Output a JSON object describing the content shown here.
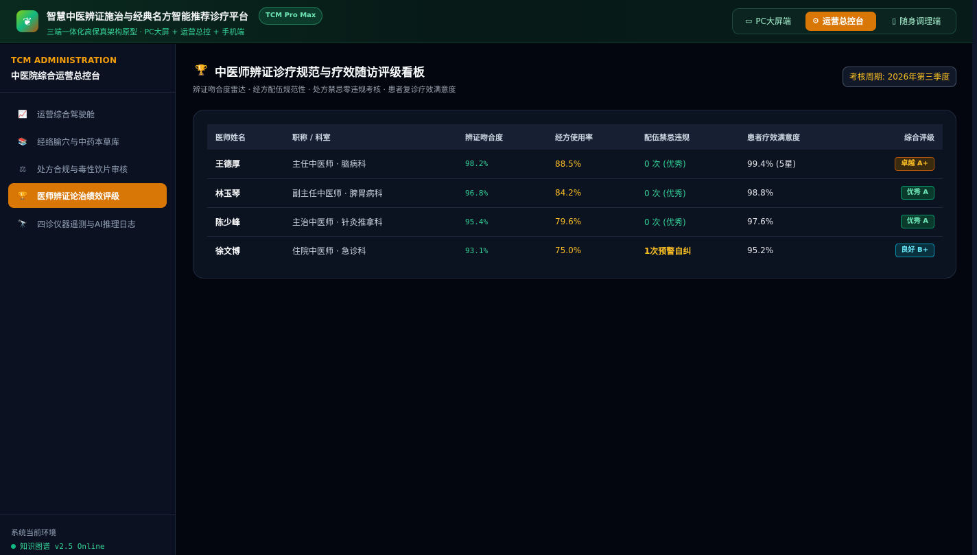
{
  "app": {
    "title": "智慧中医辨证施治与经典名方智能推荐诊疗平台",
    "badge": "TCM Pro Max",
    "subtitle": "三端一体化高保真架构原型 · PC大屏 + 运营总控 + 手机端",
    "logo_icon": "herb-leaf-icon"
  },
  "modes": [
    {
      "label": "PC大屏端",
      "icon": "monitor-icon",
      "active": false
    },
    {
      "label": "运营总控台",
      "icon": "gear-icon",
      "active": true
    },
    {
      "label": "随身调理端",
      "icon": "mobile-icon",
      "active": false
    }
  ],
  "sidebar": {
    "kicker": "TCM ADMINISTRATION",
    "title": "中医院综合运营总控台",
    "items": [
      {
        "label": "运营综合驾驶舱",
        "icon": "chart-icon",
        "active": false
      },
      {
        "label": "经络腧穴与中药本草库",
        "icon": "books-icon",
        "active": false
      },
      {
        "label": "处方合规与毒性饮片审核",
        "icon": "scales-icon",
        "active": false
      },
      {
        "label": "医师辨证论治绩效评级",
        "icon": "trophy-icon",
        "active": true
      },
      {
        "label": "四诊仪器遥测与AI推理日志",
        "icon": "telescope-icon",
        "active": false
      }
    ],
    "env_label": "系统当前环境",
    "env_status": "知识图谱 v2.5 Online"
  },
  "page": {
    "icon": "trophy-icon",
    "title": "中医师辨证诊疗规范与疗效随访评级看板",
    "subtitle": "辨证吻合度雷达 · 经方配伍规范性 · 处方禁忌零违规考核 · 患者复诊疗效满意度",
    "period": "考核周期: 2026年第三季度"
  },
  "table": {
    "headers": [
      "医师姓名",
      "职称 / 科室",
      "辨证吻合度",
      "经方使用率",
      "配伍禁忌违规",
      "患者疗效满意度",
      "综合评级"
    ],
    "rows": [
      {
        "name": "王德厚",
        "title": "主任中医师 · 脑病科",
        "match": "98.2%",
        "usage": "88.5%",
        "violation": "0 次 (优秀)",
        "violation_level": "ok",
        "satisfaction": "99.4% (5星)",
        "grade": "卓越 A+",
        "grade_style": "gold"
      },
      {
        "name": "林玉琴",
        "title": "副主任中医师 · 脾胃病科",
        "match": "96.8%",
        "usage": "84.2%",
        "violation": "0 次 (优秀)",
        "violation_level": "ok",
        "satisfaction": "98.8%",
        "grade": "优秀 A",
        "grade_style": "green"
      },
      {
        "name": "陈少峰",
        "title": "主治中医师 · 针灸推拿科",
        "match": "95.4%",
        "usage": "79.6%",
        "violation": "0 次 (优秀)",
        "violation_level": "ok",
        "satisfaction": "97.6%",
        "grade": "优秀 A",
        "grade_style": "green"
      },
      {
        "name": "徐文博",
        "title": "住院中医师 · 急诊科",
        "match": "93.1%",
        "usage": "75.0%",
        "violation": "1次预警自纠",
        "violation_level": "warn",
        "satisfaction": "95.2%",
        "grade": "良好 B+",
        "grade_style": "blue"
      }
    ]
  },
  "colors": {
    "accent": "#d97706",
    "good": "#34d399",
    "warn": "#fbbf24",
    "background": "#03060f"
  }
}
